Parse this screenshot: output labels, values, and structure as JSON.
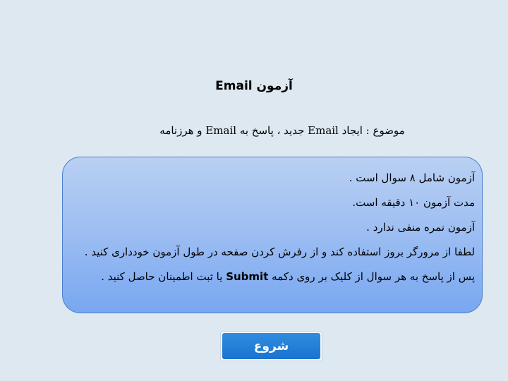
{
  "header": {
    "title": "آزمون Email",
    "subject": "موضوع : ایجاد Email جدید ، پاسخ به Email و هرزنامه"
  },
  "info": {
    "line1": "آزمون شامل ۸ سوال است .",
    "line2": "مدت آزمون ۱۰ دقیقه است.",
    "line3": "آزمون نمره منفی ندارد .",
    "line4": "لطفا از مرورگر بروز استفاده کند و از رفرش کردن صفحه در طول آزمون خودداری کنید .",
    "line5_before": "پس از پاسخ به هر سوال از کلیک بر روی دکمه ",
    "line5_keyword": "Submit",
    "line5_after": " یا ثبت اطمینان حاصل کنید ."
  },
  "actions": {
    "start_label": "شروع"
  }
}
